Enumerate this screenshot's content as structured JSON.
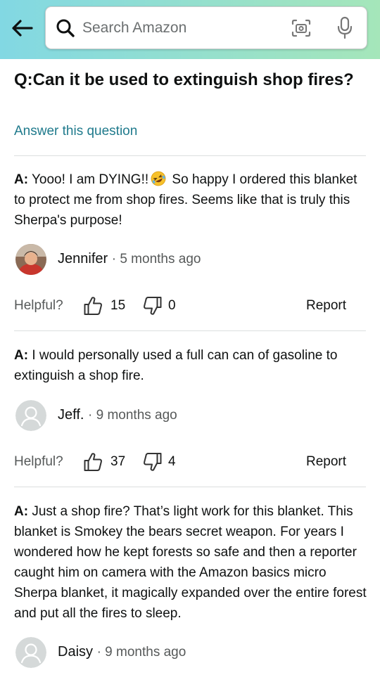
{
  "search": {
    "placeholder": "Search Amazon"
  },
  "question": {
    "text": "Q:Can it be used to extinguish shop fires?",
    "answer_link": "Answer this question"
  },
  "helpful_label": "Helpful?",
  "report_label": "Report",
  "answers": [
    {
      "prefix": "A:",
      "text_before_emoji": " Yooo! I am DYING!!",
      "emoji": "rolling-on-floor-laughing",
      "text_after_emoji": " So happy I ordered this blanket to protect me from shop fires. Seems like that is truly this Sherpa's purpose!",
      "author": "Jennifer",
      "time": "· 5 months ago",
      "avatar": "photo",
      "upvotes": "15",
      "downvotes": "0"
    },
    {
      "prefix": "A:",
      "text": " I would personally used a full can can of gasoline to extinguish a shop fire.",
      "author": "Jeff.",
      "time": "· 9 months ago",
      "avatar": "default",
      "upvotes": "37",
      "downvotes": "4"
    },
    {
      "prefix": "A:",
      "text": " Just a shop fire? That’s light work for this blanket. This blanket is Smokey the bears secret weapon. For years I wondered how he kept forests so safe and then a reporter caught him on camera with the Amazon basics micro Sherpa blanket, it magically expanded over the entire forest and put all the fires to sleep.",
      "author": "Daisy",
      "time": "· 9 months ago",
      "avatar": "default"
    }
  ],
  "colors": {
    "link": "#1f7a8c",
    "header_start": "#82d8e3",
    "header_end": "#a5e6ba"
  }
}
